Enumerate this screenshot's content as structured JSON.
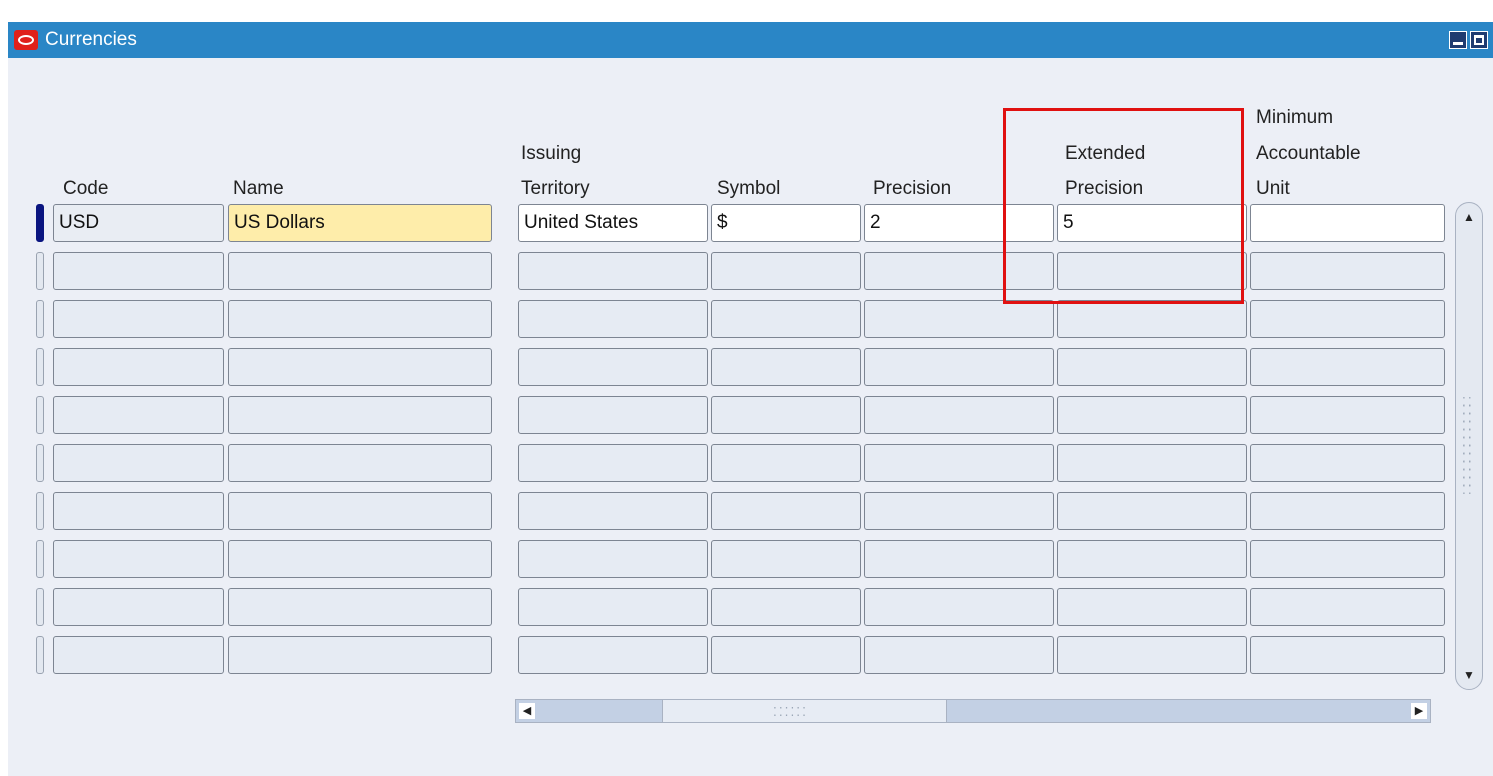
{
  "window": {
    "title": "Currencies"
  },
  "columns": {
    "code": "Code",
    "name": "Name",
    "territory": [
      "Issuing",
      "Territory"
    ],
    "symbol": "Symbol",
    "precision": "Precision",
    "extended_precision": [
      "Extended",
      "Precision"
    ],
    "mau": [
      "Minimum",
      "Accountable",
      "Unit"
    ]
  },
  "rows": [
    {
      "code": "USD",
      "name": "US Dollars",
      "territory": "United States",
      "symbol": "$",
      "precision": "2",
      "extended_precision": "5",
      "mau": ""
    }
  ],
  "empty_rows": 9,
  "icons": {
    "logo": "oracle-logo-icon",
    "minimize": "minimize-icon",
    "maximize": "maximize-icon",
    "scroll_up": "scroll-up-arrow-icon",
    "scroll_down": "scroll-down-arrow-icon",
    "scroll_left": "scroll-left-arrow-icon",
    "scroll_right": "scroll-right-arrow-icon"
  },
  "colors": {
    "titlebar": "#2A86C6",
    "highlight_box": "#E01010",
    "active_field": "#FEEDAA",
    "current_record": "#0A1580"
  }
}
